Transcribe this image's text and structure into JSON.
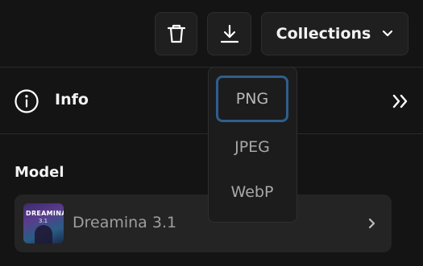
{
  "toolbar": {
    "delete_icon": "trash-icon",
    "download_icon": "download-icon",
    "collections_label": "Collections",
    "collections_icon": "chevron-down-icon"
  },
  "info": {
    "icon": "info-icon",
    "label": "Info",
    "expand_icon": "double-chevron-right-icon"
  },
  "model": {
    "heading": "Model",
    "name": "Dreamina 3.1",
    "thumbnail_text": "DREAMINA",
    "thumbnail_version": "3.1",
    "chevron_icon": "chevron-right-icon"
  },
  "download_menu": {
    "options": [
      "PNG",
      "JPEG",
      "WebP"
    ],
    "selected": "PNG"
  },
  "colors": {
    "background": "#141414",
    "button_bg": "#1f1f1f",
    "card_bg": "#242424",
    "focus_ring": "#2f5e8e"
  }
}
